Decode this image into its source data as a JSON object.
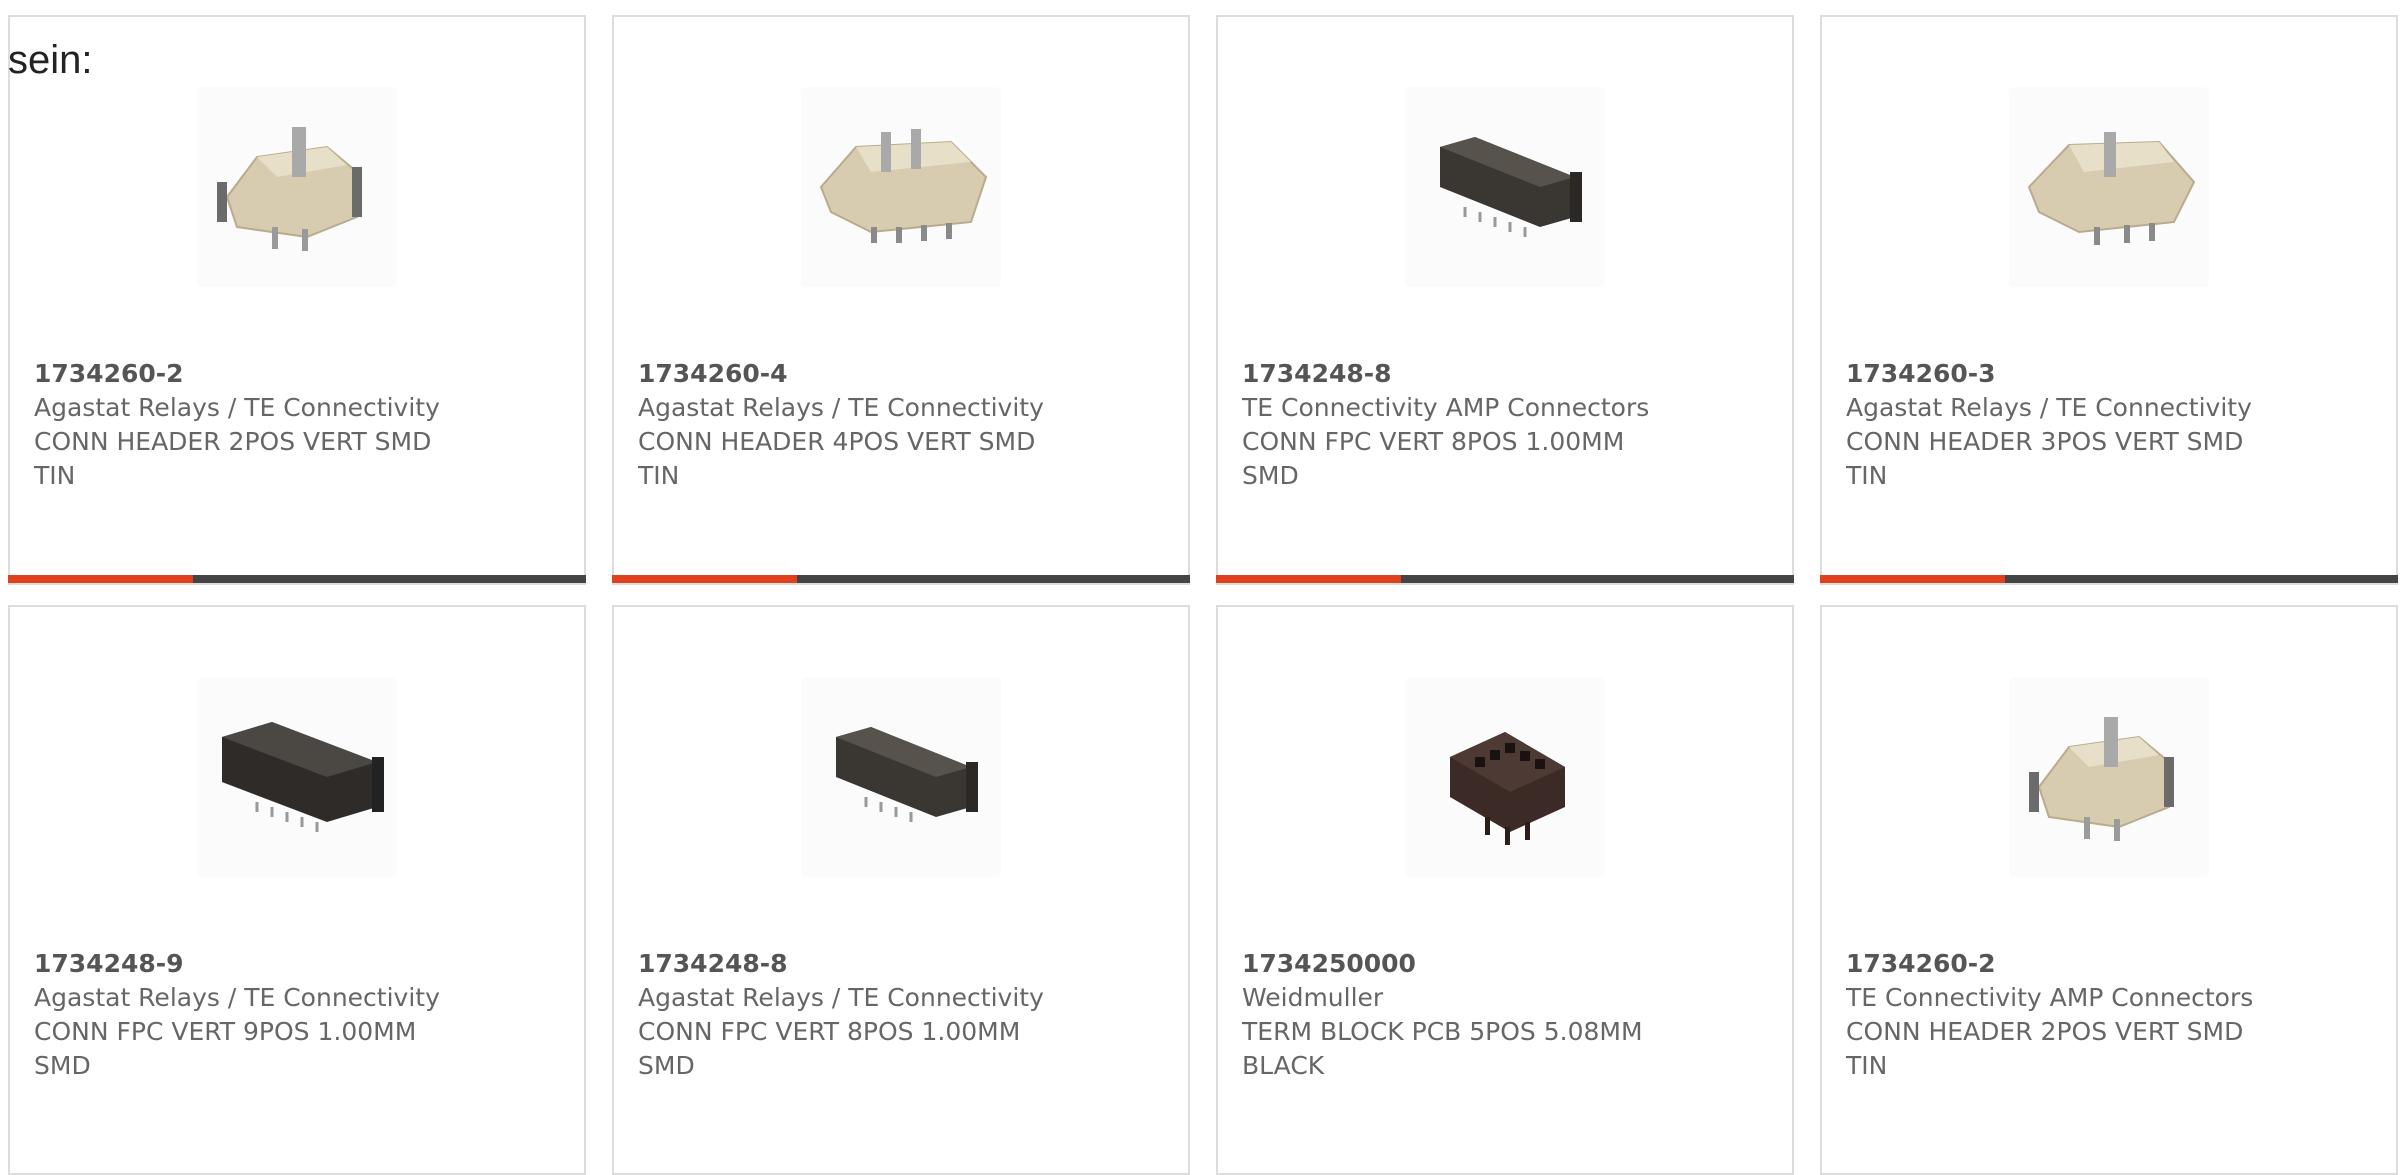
{
  "intro_text": "sein:",
  "accent_color": "#e0401b",
  "bar_color": "#444444",
  "products": [
    {
      "part": "1734260-2",
      "manufacturer": "Agastat Relays / TE Connectivity",
      "desc1": "CONN HEADER 2POS VERT SMD",
      "desc2": "TIN",
      "image_icon": "beige-header-connector-icon"
    },
    {
      "part": "1734260-4",
      "manufacturer": "Agastat Relays / TE Connectivity",
      "desc1": "CONN HEADER 4POS VERT SMD",
      "desc2": "TIN",
      "image_icon": "beige-header-connector-icon"
    },
    {
      "part": "1734248-8",
      "manufacturer": "TE Connectivity AMP Connectors",
      "desc1": "CONN FPC VERT 8POS 1.00MM",
      "desc2": "SMD",
      "image_icon": "black-fpc-connector-icon"
    },
    {
      "part": "1734260-3",
      "manufacturer": "Agastat Relays / TE Connectivity",
      "desc1": "CONN HEADER 3POS VERT SMD",
      "desc2": "TIN",
      "image_icon": "beige-header-connector-icon"
    },
    {
      "part": "1734248-9",
      "manufacturer": "Agastat Relays / TE Connectivity",
      "desc1": "CONN FPC VERT 9POS 1.00MM",
      "desc2": "SMD",
      "image_icon": "black-fpc-connector-icon"
    },
    {
      "part": "1734248-8",
      "manufacturer": "Agastat Relays / TE Connectivity",
      "desc1": "CONN FPC VERT 8POS 1.00MM",
      "desc2": "SMD",
      "image_icon": "black-fpc-connector-icon"
    },
    {
      "part": "1734250000",
      "manufacturer": "Weidmuller",
      "desc1": "TERM BLOCK PCB 5POS 5.08MM",
      "desc2": "BLACK",
      "image_icon": "terminal-block-icon"
    },
    {
      "part": "1734260-2",
      "manufacturer": "TE Connectivity AMP Connectors",
      "desc1": "CONN HEADER 2POS VERT SMD",
      "desc2": "TIN",
      "image_icon": "beige-header-connector-icon"
    }
  ]
}
